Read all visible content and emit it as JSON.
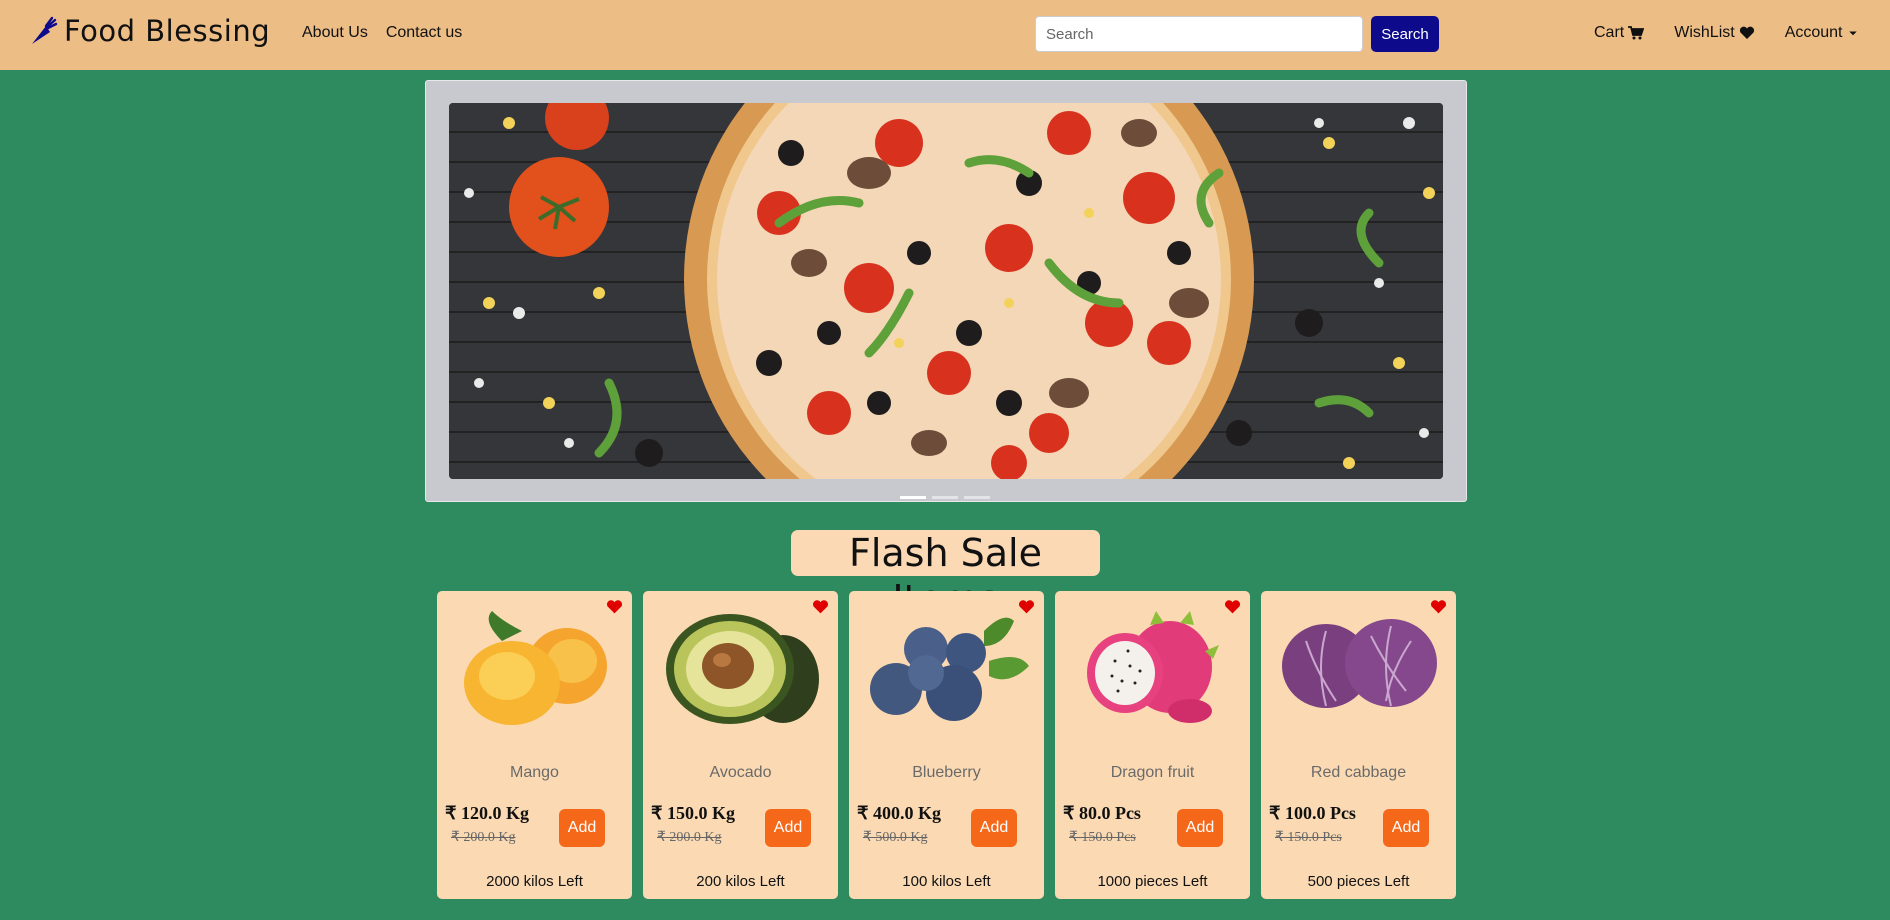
{
  "brand": {
    "name": "Food Blessing"
  },
  "nav": {
    "about": "About Us",
    "contact": "Contact us",
    "cart": "Cart",
    "wishlist": "WishList",
    "account": "Account"
  },
  "search": {
    "placeholder": "Search",
    "button": "Search"
  },
  "carousel": {
    "slides": 3,
    "active": 0
  },
  "section": {
    "title": "Flash Sale Items"
  },
  "colors": {
    "navbar": "#edbd86",
    "background": "#2e8b5f",
    "card": "#fbdab3",
    "add_button": "#f5681a",
    "search_button": "#0e0a8c",
    "heart": "#e00000"
  },
  "products": [
    {
      "name": "Mango",
      "price": "₹ 120.0 Kg",
      "old_price": "₹ 200.0 Kg",
      "add": "Add",
      "stock": "2000 kilos Left"
    },
    {
      "name": "Avocado",
      "price": "₹ 150.0 Kg",
      "old_price": "₹ 200.0 Kg",
      "add": "Add",
      "stock": "200 kilos Left"
    },
    {
      "name": "Blueberry",
      "price": "₹ 400.0 Kg",
      "old_price": "₹ 500.0 Kg",
      "add": "Add",
      "stock": "100 kilos Left"
    },
    {
      "name": "Dragon fruit",
      "price": "₹ 80.0 Pcs",
      "old_price": "₹ 150.0 Pcs",
      "add": "Add",
      "stock": "1000 pieces Left"
    },
    {
      "name": "Red cabbage",
      "price": "₹ 100.0 Pcs",
      "old_price": "₹ 150.0 Pcs",
      "add": "Add",
      "stock": "500 pieces Left"
    }
  ]
}
